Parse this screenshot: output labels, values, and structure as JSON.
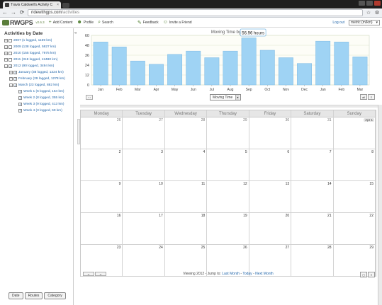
{
  "browser": {
    "tab_title": "Travis Caldwell's Activity C",
    "tab_close": "×",
    "url_host": "ridewithgps.com",
    "url_path": "/activities",
    "back_glyph": "←",
    "forward_glyph": "→",
    "reload_glyph": "⟳",
    "home_glyph": "⌂",
    "star_glyph": "☆",
    "wrench_glyph": "⚙"
  },
  "header": {
    "logo_text": "RWGPS",
    "version": "v2.6.3",
    "nav": [
      {
        "label": "Add Content",
        "icon": "+"
      },
      {
        "label": "Profile",
        "icon": "☻"
      },
      {
        "label": "Search",
        "icon": "⌕"
      },
      {
        "label": "Feedback",
        "icon": "✎"
      },
      {
        "label": "Invite a Friend",
        "icon": "☺"
      }
    ],
    "logout": "Log out",
    "units": "metric (m/km)",
    "units_arrow": "▾"
  },
  "sidebar": {
    "title": "Activities by Date",
    "tree": [
      {
        "label": "2007 (1 logged, 1169 km)",
        "expander": "+",
        "checked": false,
        "indent": 0
      },
      {
        "label": "2009 (138 logged, 5827 km)",
        "expander": "+",
        "checked": false,
        "indent": 0
      },
      {
        "label": "2010 (155 logged, 7975 km)",
        "expander": "+",
        "checked": false,
        "indent": 0
      },
      {
        "label": "2011 (318 logged, 12480 km)",
        "expander": "+",
        "checked": false,
        "indent": 0
      },
      {
        "label": "2012 (90 logged, 3494 km)",
        "expander": "−",
        "checked": true,
        "indent": 0
      },
      {
        "label": "January (38 logged, 1324 km)",
        "expander": "+",
        "checked": true,
        "indent": 1
      },
      {
        "label": "February (29 logged, 1278 km)",
        "expander": "+",
        "checked": true,
        "indent": 1
      },
      {
        "label": "March (23 logged, 882 km)",
        "expander": "−",
        "checked": true,
        "indent": 1
      },
      {
        "label": "Week 1 (6 logged, 154 km)",
        "expander": "",
        "checked": true,
        "indent": 2
      },
      {
        "label": "Week 2 (8 logged, 355 km)",
        "expander": "",
        "checked": true,
        "indent": 2
      },
      {
        "label": "Week 3 (9 logged, 413 km)",
        "expander": "",
        "checked": true,
        "indent": 2
      },
      {
        "label": "Week 4 (3 logged, 69 km)",
        "expander": "",
        "checked": true,
        "indent": 2
      }
    ],
    "footer_buttons": [
      "Date",
      "Routes",
      "Category"
    ],
    "collapse_glyph": "«"
  },
  "chart_data": {
    "type": "bar",
    "title": "Moving Time by Month",
    "categories": [
      "Jan",
      "Feb",
      "Mar",
      "Apr",
      "May",
      "Jun",
      "Jul",
      "Aug",
      "Sep",
      "Oct",
      "Nov",
      "Dec",
      "Jan",
      "Feb",
      "Mar"
    ],
    "values": [
      52,
      46,
      29,
      25,
      37,
      41,
      33,
      41,
      57,
      42,
      33,
      26,
      53,
      52,
      34
    ],
    "yticks": [
      0,
      12,
      24,
      36,
      48,
      60
    ],
    "ylim": [
      0,
      60
    ],
    "grid": true,
    "bar_color": "#9fd3f4",
    "bar_stroke": "#7ab8e3",
    "tooltip": {
      "text": "56.96 hours",
      "index": 8
    }
  },
  "chart_controls": {
    "pager": "‹ ›",
    "metric": "Moving Time",
    "metric_arrow": "▾",
    "view_buttons": [
      "all",
      "≡"
    ]
  },
  "calendar": {
    "days": [
      "Monday",
      "Tuesday",
      "Wednesday",
      "Thursday",
      "Friday",
      "Saturday",
      "Sunday"
    ],
    "weeks": [
      [
        {
          "d": "26",
          "alt": true
        },
        {
          "d": "27",
          "alt": true
        },
        {
          "d": "28",
          "alt": true
        },
        {
          "d": "29",
          "alt": true
        },
        {
          "d": "30",
          "alt": true
        },
        {
          "d": "31",
          "alt": true
        },
        {
          "d": "Apr 1",
          "alt": false,
          "badge": true
        }
      ],
      [
        {
          "d": "2"
        },
        {
          "d": "3"
        },
        {
          "d": "4"
        },
        {
          "d": "5"
        },
        {
          "d": "6"
        },
        {
          "d": "7"
        },
        {
          "d": "8"
        }
      ],
      [
        {
          "d": "9"
        },
        {
          "d": "10"
        },
        {
          "d": "11"
        },
        {
          "d": "12"
        },
        {
          "d": "13"
        },
        {
          "d": "14"
        },
        {
          "d": "15"
        }
      ],
      [
        {
          "d": "16"
        },
        {
          "d": "17"
        },
        {
          "d": "18"
        },
        {
          "d": "19"
        },
        {
          "d": "20"
        },
        {
          "d": "21"
        },
        {
          "d": "22"
        }
      ],
      [
        {
          "d": "23"
        },
        {
          "d": "24"
        },
        {
          "d": "25"
        },
        {
          "d": "26"
        },
        {
          "d": "27"
        },
        {
          "d": "28"
        },
        {
          "d": "29"
        }
      ]
    ],
    "footer": {
      "viewing": "Viewing 2012 - Jump to:",
      "last_month": "Last Month",
      "sep1": " - ",
      "today": "Today",
      "sep2": " - ",
      "next_month": "Next Month",
      "nav_prev": "‹‹",
      "nav_next": "››",
      "view_buttons": [
        "▢",
        "≡"
      ]
    }
  }
}
